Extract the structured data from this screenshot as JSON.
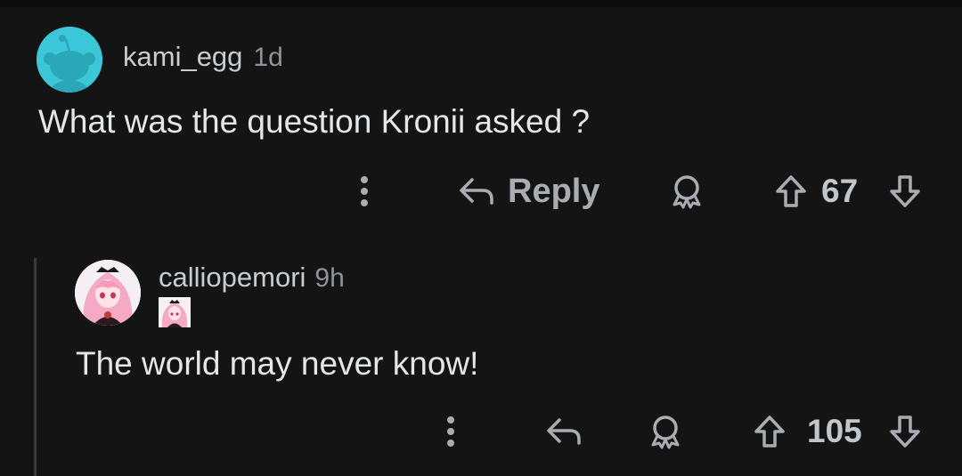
{
  "comments": [
    {
      "username": "kami_egg",
      "age": "1d",
      "body": "What was the question Kronii asked ?",
      "reply_label": "Reply",
      "score": "67",
      "avatar_icon": "snoo-default-avatar-icon"
    },
    {
      "username": "calliopemori",
      "age": "9h",
      "body": "The world may never know!",
      "score": "105",
      "avatar_icon": "anime-girl-avatar-icon",
      "flair_icon": "anime-girl-flair-icon"
    }
  ],
  "colors": {
    "background": "#141414",
    "avatar_teal": "#3bc7d8",
    "text": "#e4e6e8",
    "muted": "#8f9498"
  }
}
